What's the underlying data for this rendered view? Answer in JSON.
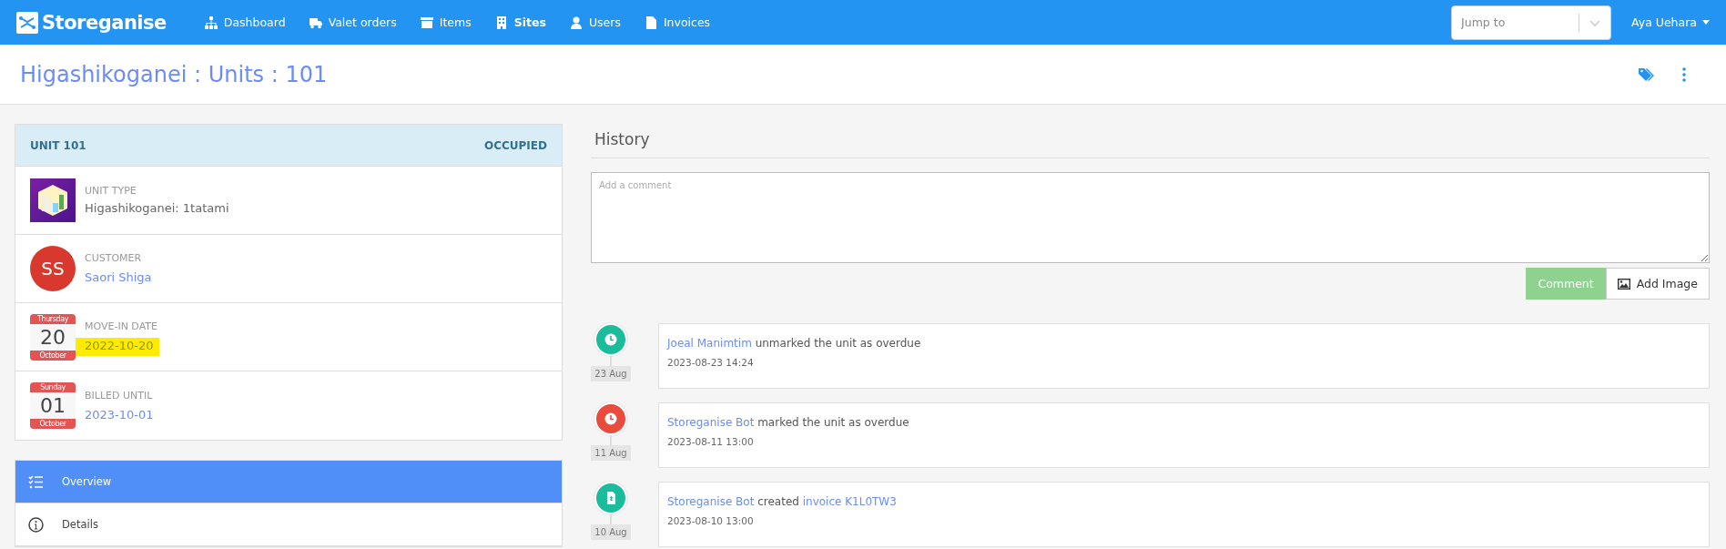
{
  "navbar": {
    "brand": "Storeganise",
    "items": [
      {
        "label": "Dashboard",
        "selected": false
      },
      {
        "label": "Valet orders",
        "selected": false
      },
      {
        "label": "Items",
        "selected": false
      },
      {
        "label": "Sites",
        "selected": true
      },
      {
        "label": "Users",
        "selected": false
      },
      {
        "label": "Invoices",
        "selected": false
      }
    ],
    "jump_to": {
      "placeholder": "Jump to"
    },
    "user": "Aya Uehara"
  },
  "page_title": "Higashikoganei : Units : 101",
  "unit_card": {
    "title": "UNIT 101",
    "status": "OCCUPIED",
    "rows": [
      {
        "kind": "image",
        "label": "UNIT TYPE",
        "value": "Higashikoganei: 1tatami",
        "link": false,
        "highlighted": false
      },
      {
        "kind": "avatar",
        "initials": "SS",
        "label": "CUSTOMER",
        "value": "Saori Shiga",
        "link": true,
        "highlighted": false
      },
      {
        "kind": "calendar",
        "weekday": "Thursday",
        "day": "20",
        "month": "October",
        "label": "MOVE-IN DATE",
        "value": "2022-10-20",
        "link": true,
        "highlighted": true
      },
      {
        "kind": "calendar",
        "weekday": "Sunday",
        "day": "01",
        "month": "October",
        "label": "BILLED UNTIL",
        "value": "2023-10-01",
        "link": true,
        "highlighted": false
      }
    ]
  },
  "menu": [
    {
      "label": "Overview",
      "selected": true
    },
    {
      "label": "Details",
      "selected": false
    }
  ],
  "history": {
    "title": "History",
    "comment": {
      "placeholder": "Add a comment"
    },
    "buttons": [
      {
        "label": "Comment",
        "kind": "primary"
      },
      {
        "label": "Add Image",
        "kind": "image"
      }
    ],
    "entries": [
      {
        "kind": "status",
        "color": "#1abc9c",
        "date": "23 Aug",
        "time": "2023-08-23 14:24",
        "parts": [
          {
            "kind": "link",
            "text": "Joeal Manimtim"
          },
          {
            "kind": "text",
            "text": " unmarked the unit as overdue"
          }
        ]
      },
      {
        "kind": "status",
        "color": "#e74c3c",
        "date": "11 Aug",
        "time": "2023-08-11 13:00",
        "parts": [
          {
            "kind": "link",
            "text": "Storeganise Bot"
          },
          {
            "kind": "text",
            "text": " marked the unit as overdue"
          }
        ]
      },
      {
        "kind": "invoice",
        "color": "#1abc9c",
        "date": "10 Aug",
        "time": "2023-08-10 13:00",
        "parts": [
          {
            "kind": "link",
            "text": "Storeganise Bot"
          },
          {
            "kind": "text",
            "text": " created "
          },
          {
            "kind": "link",
            "text": "invoice K1L0TW3"
          }
        ]
      }
    ]
  }
}
